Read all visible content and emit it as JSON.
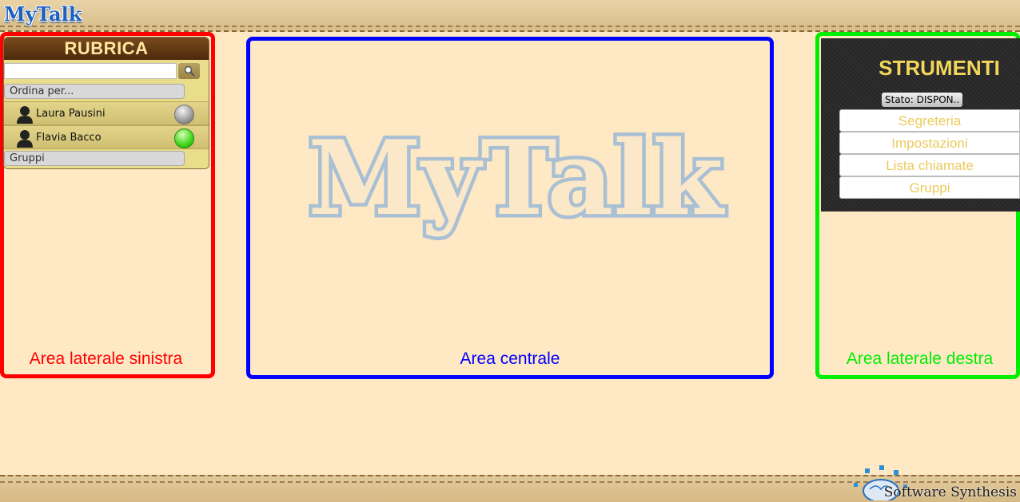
{
  "header": {
    "logo_text": "MyTalk"
  },
  "left_panel": {
    "title": "RUBRICA",
    "search": {
      "placeholder": "",
      "value": ""
    },
    "sort_label": "Ordina per...",
    "contacts": [
      {
        "name": "Laura Pausini",
        "status": "offline"
      },
      {
        "name": "Flavia Bacco",
        "status": "online"
      }
    ],
    "groups_label": "Gruppi",
    "area_label": "Area laterale sinistra",
    "frame_color": "#ff0000"
  },
  "center": {
    "logo_text": "MyTalk",
    "area_label": "Area centrale",
    "frame_color": "#0000ff"
  },
  "right_panel": {
    "title": "STRUMENTI",
    "status": "Stato: DISPON..",
    "tools": [
      "Segreteria",
      "Impostazioni",
      "Lista chiamate",
      "Gruppi"
    ],
    "area_label": "Area laterale destra",
    "frame_color": "#00ee00"
  },
  "footer": {
    "brand": "Software Synthesis"
  },
  "colors": {
    "background": "#ffe8c4",
    "accent_gold": "#f2d75a",
    "logo_blue": "#1d5fbf"
  }
}
